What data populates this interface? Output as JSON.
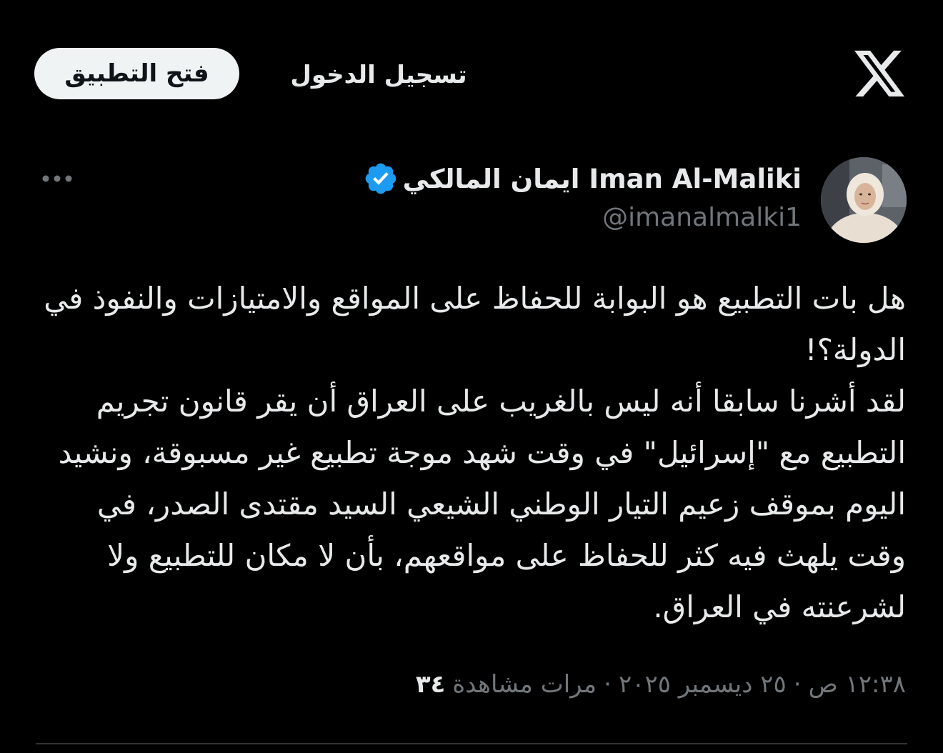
{
  "header": {
    "open_app_label": "فتح التطبيق",
    "login_label": "تسجيل الدخول",
    "logo_icon": "x-logo-icon"
  },
  "author": {
    "display_name": "Iman Al-Maliki ايمان المالكي",
    "handle": "@imanalmalki1",
    "verified": true,
    "verified_color": "#1d9bf0"
  },
  "tweet": {
    "text": "هل بات التطبيع هو البوابة للحفاظ على المواقع والامتيازات والنفوذ في الدولة؟!\nلقد أشرنا سابقا أنه ليس بالغريب على العراق أن يقر قانون تجريم التطبيع مع \"إسرائيل\" في وقت شهد موجة تطبيع غير مسبوقة، ونشيد اليوم بموقف زعيم التيار الوطني الشيعي السيد مقتدى الصدر، في وقت يلهث فيه كثر للحفاظ على مواقعهم، بأن لا مكان للتطبيع ولا لشرعنته في العراق.",
    "time": "١٢:٣٨ ص",
    "date": "٢٥ ديسمبر ٢٠٢٥",
    "views_label": "مرات مشاهدة",
    "views_count": "٣٤",
    "separator": "·"
  },
  "colors": {
    "background": "#000000",
    "text_primary": "#e7e9ea",
    "text_secondary": "#71767b",
    "button_bg": "#eff3f4"
  }
}
